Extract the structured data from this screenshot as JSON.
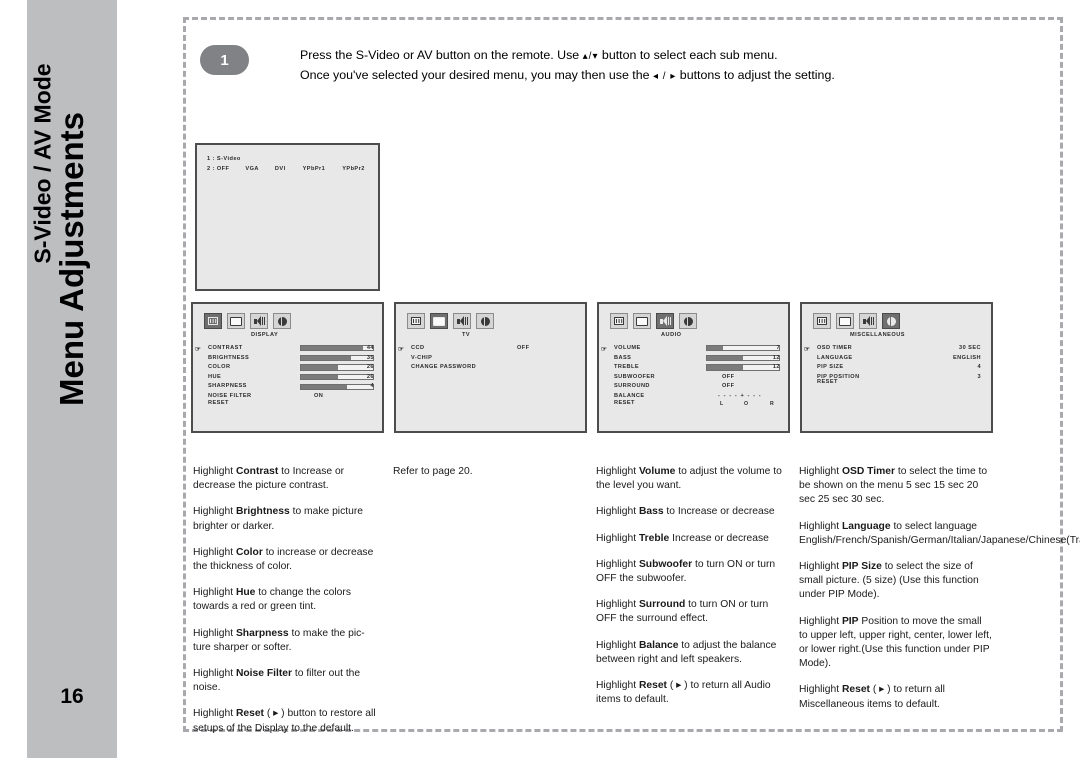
{
  "rail": {
    "title": "Menu Adjustments",
    "subtitle": "S-Video / AV Mode",
    "page_number": "16",
    "band_color": "#bcbec0"
  },
  "step": {
    "number": "1",
    "line1_a": "Press the S-Video or AV button on the remote. Use",
    "line1_glyph": "▴/▾",
    "line1_b": "button to select each sub menu.",
    "line2_a": "Once you've selected your desired menu, you may then use the",
    "line2_glyph": "◂ / ▸",
    "line2_b": "buttons to adjust the setting."
  },
  "source_screen": {
    "line1": "1 : S-Video",
    "line2_label": "2 : OFF",
    "line2_options": [
      "VGA",
      "DVI",
      "YPbPr1",
      "YPbPr2"
    ]
  },
  "osd_panels": [
    {
      "title": "DISPLAY",
      "selected_icon": 0,
      "icons": [
        "display-icon",
        "tv-icon",
        "audio-icon",
        "misc-icon"
      ],
      "rows": [
        {
          "label": "CONTRAST",
          "cursor": true,
          "type": "bar",
          "value": "44",
          "fill_pct": 86
        },
        {
          "label": "BRIGHTNESS",
          "cursor": false,
          "type": "bar",
          "value": "35",
          "fill_pct": 70
        },
        {
          "label": "COLOR",
          "cursor": false,
          "type": "bar",
          "value": "26",
          "fill_pct": 52
        },
        {
          "label": "HUE",
          "cursor": false,
          "type": "bar",
          "value": "26",
          "fill_pct": 52
        },
        {
          "label": "SHARPNESS",
          "cursor": false,
          "type": "bar",
          "value": "4",
          "fill_pct": 64
        },
        {
          "label": "NOISE FILTER",
          "cursor": false,
          "type": "text",
          "value": "ON"
        }
      ],
      "reset": "RESET<I>"
    },
    {
      "title": "TV",
      "selected_icon": 1,
      "icons": [
        "display-icon",
        "tv-icon",
        "audio-icon",
        "misc-icon"
      ],
      "rows": [
        {
          "label": "CCD",
          "cursor": true,
          "type": "text",
          "value": "OFF"
        },
        {
          "label": "V-CHIP",
          "cursor": false,
          "type": "none",
          "value": ""
        },
        {
          "label": "CHANGE PASSWORD",
          "cursor": false,
          "type": "none",
          "value": ""
        }
      ],
      "reset": ""
    },
    {
      "title": "AUDIO",
      "selected_icon": 2,
      "icons": [
        "display-icon",
        "tv-icon",
        "audio-icon",
        "misc-icon"
      ],
      "rows": [
        {
          "label": "VOLUME",
          "cursor": true,
          "type": "bar",
          "value": "7",
          "fill_pct": 22
        },
        {
          "label": "BASS",
          "cursor": false,
          "type": "bar",
          "value": "12",
          "fill_pct": 50
        },
        {
          "label": "TREBLE",
          "cursor": false,
          "type": "bar",
          "value": "12",
          "fill_pct": 50
        },
        {
          "label": "SUBWOOFER",
          "cursor": false,
          "type": "text",
          "value": "OFF"
        },
        {
          "label": "SURROUND",
          "cursor": false,
          "type": "text",
          "value": "OFF"
        },
        {
          "label": "BALANCE",
          "cursor": false,
          "type": "balance",
          "value": "- - - - + - - -",
          "left": "L",
          "center": "O",
          "right": "R"
        }
      ],
      "reset": "RESET<I>"
    },
    {
      "title": "MISCELLANEOUS",
      "selected_icon": 3,
      "icons": [
        "display-icon",
        "tv-icon",
        "audio-icon",
        "misc-icon"
      ],
      "rows": [
        {
          "label": "OSD TIMER",
          "cursor": true,
          "type": "text",
          "value": "30 SEC"
        },
        {
          "label": "LANGUAGE",
          "cursor": false,
          "type": "text",
          "value": "ENGLISH"
        },
        {
          "label": "PIP SIZE",
          "cursor": false,
          "type": "text",
          "value": "4"
        },
        {
          "label": "PIP POSITION",
          "cursor": false,
          "type": "text",
          "value": "3"
        }
      ],
      "reset": "RESET<I>"
    }
  ],
  "columns": [
    {
      "paragraphs": [
        {
          "pre": "Highlight ",
          "bold": "Contrast",
          "post": " to Increase or decrease the picture contrast."
        },
        {
          "pre": "Highlight ",
          "bold": "Brightness",
          "post": " to make picture brighter or darker."
        },
        {
          "pre": "Highlight ",
          "bold": "Color",
          "post": " to increase or decrease the thickness of color."
        },
        {
          "pre": "Highlight ",
          "bold": "Hue",
          "post": " to change the colors towards a red or green tint."
        },
        {
          "pre": "Highlight ",
          "bold": "Sharpness",
          "post": " to make the pic-ture sharper or softer."
        },
        {
          "pre": "Highlight ",
          "bold": "Noise Filter",
          "post": " to filter out the noise."
        },
        {
          "pre": "Highlight ",
          "bold": "Reset",
          "post": " ( ▸ ) button to restore all setups of the Display to the default."
        }
      ]
    },
    {
      "paragraphs": [
        {
          "pre": "Refer to page 20.",
          "bold": "",
          "post": ""
        }
      ]
    },
    {
      "paragraphs": [
        {
          "pre": "Highlight ",
          "bold": "Volume",
          "post": " to adjust the volume to the level you want."
        },
        {
          "pre": "Highlight ",
          "bold": "Bass",
          "post": " to Increase or decrease"
        },
        {
          "pre": "Highlight ",
          "bold": "Treble",
          "post": " Increase or decrease"
        },
        {
          "pre": "Highlight ",
          "bold": "Subwoofer",
          "post": " to turn ON or turn OFF the subwoofer."
        },
        {
          "pre": "Highlight ",
          "bold": "Surround",
          "post": " to turn ON or turn OFF the surround effect."
        },
        {
          "pre": "Highlight ",
          "bold": "Balance",
          "post": " to adjust the balance between right and left speakers."
        },
        {
          "pre": "Highlight ",
          "bold": "Reset",
          "post": " ( ▸ ) to return all Audio items to default."
        }
      ]
    },
    {
      "paragraphs": [
        {
          "pre": "Highlight ",
          "bold": "OSD Timer",
          "post": " to select the time to be shown on the menu 5 sec 15 sec 20 sec 25 sec 30 sec."
        },
        {
          "pre": "Highlight ",
          "bold": "Language",
          "post": " to select language English/French/Spanish/German/Italian/Japanese/Chinese(Traditional)/Chinese(Simplified)."
        },
        {
          "pre": "Highlight ",
          "bold": "PIP Size",
          "post": " to select the size of small picture. (5 size) (Use this function under PIP Mode)."
        },
        {
          "pre": "Highlight ",
          "bold": "PIP",
          "post": " Position to move the small to upper left, upper right, center, lower left, or lower right.(Use this function under PIP Mode)."
        },
        {
          "pre": "Highlight ",
          "bold": "Reset",
          "post": " ( ▸ ) to return all Miscellaneous items to default."
        }
      ]
    }
  ]
}
